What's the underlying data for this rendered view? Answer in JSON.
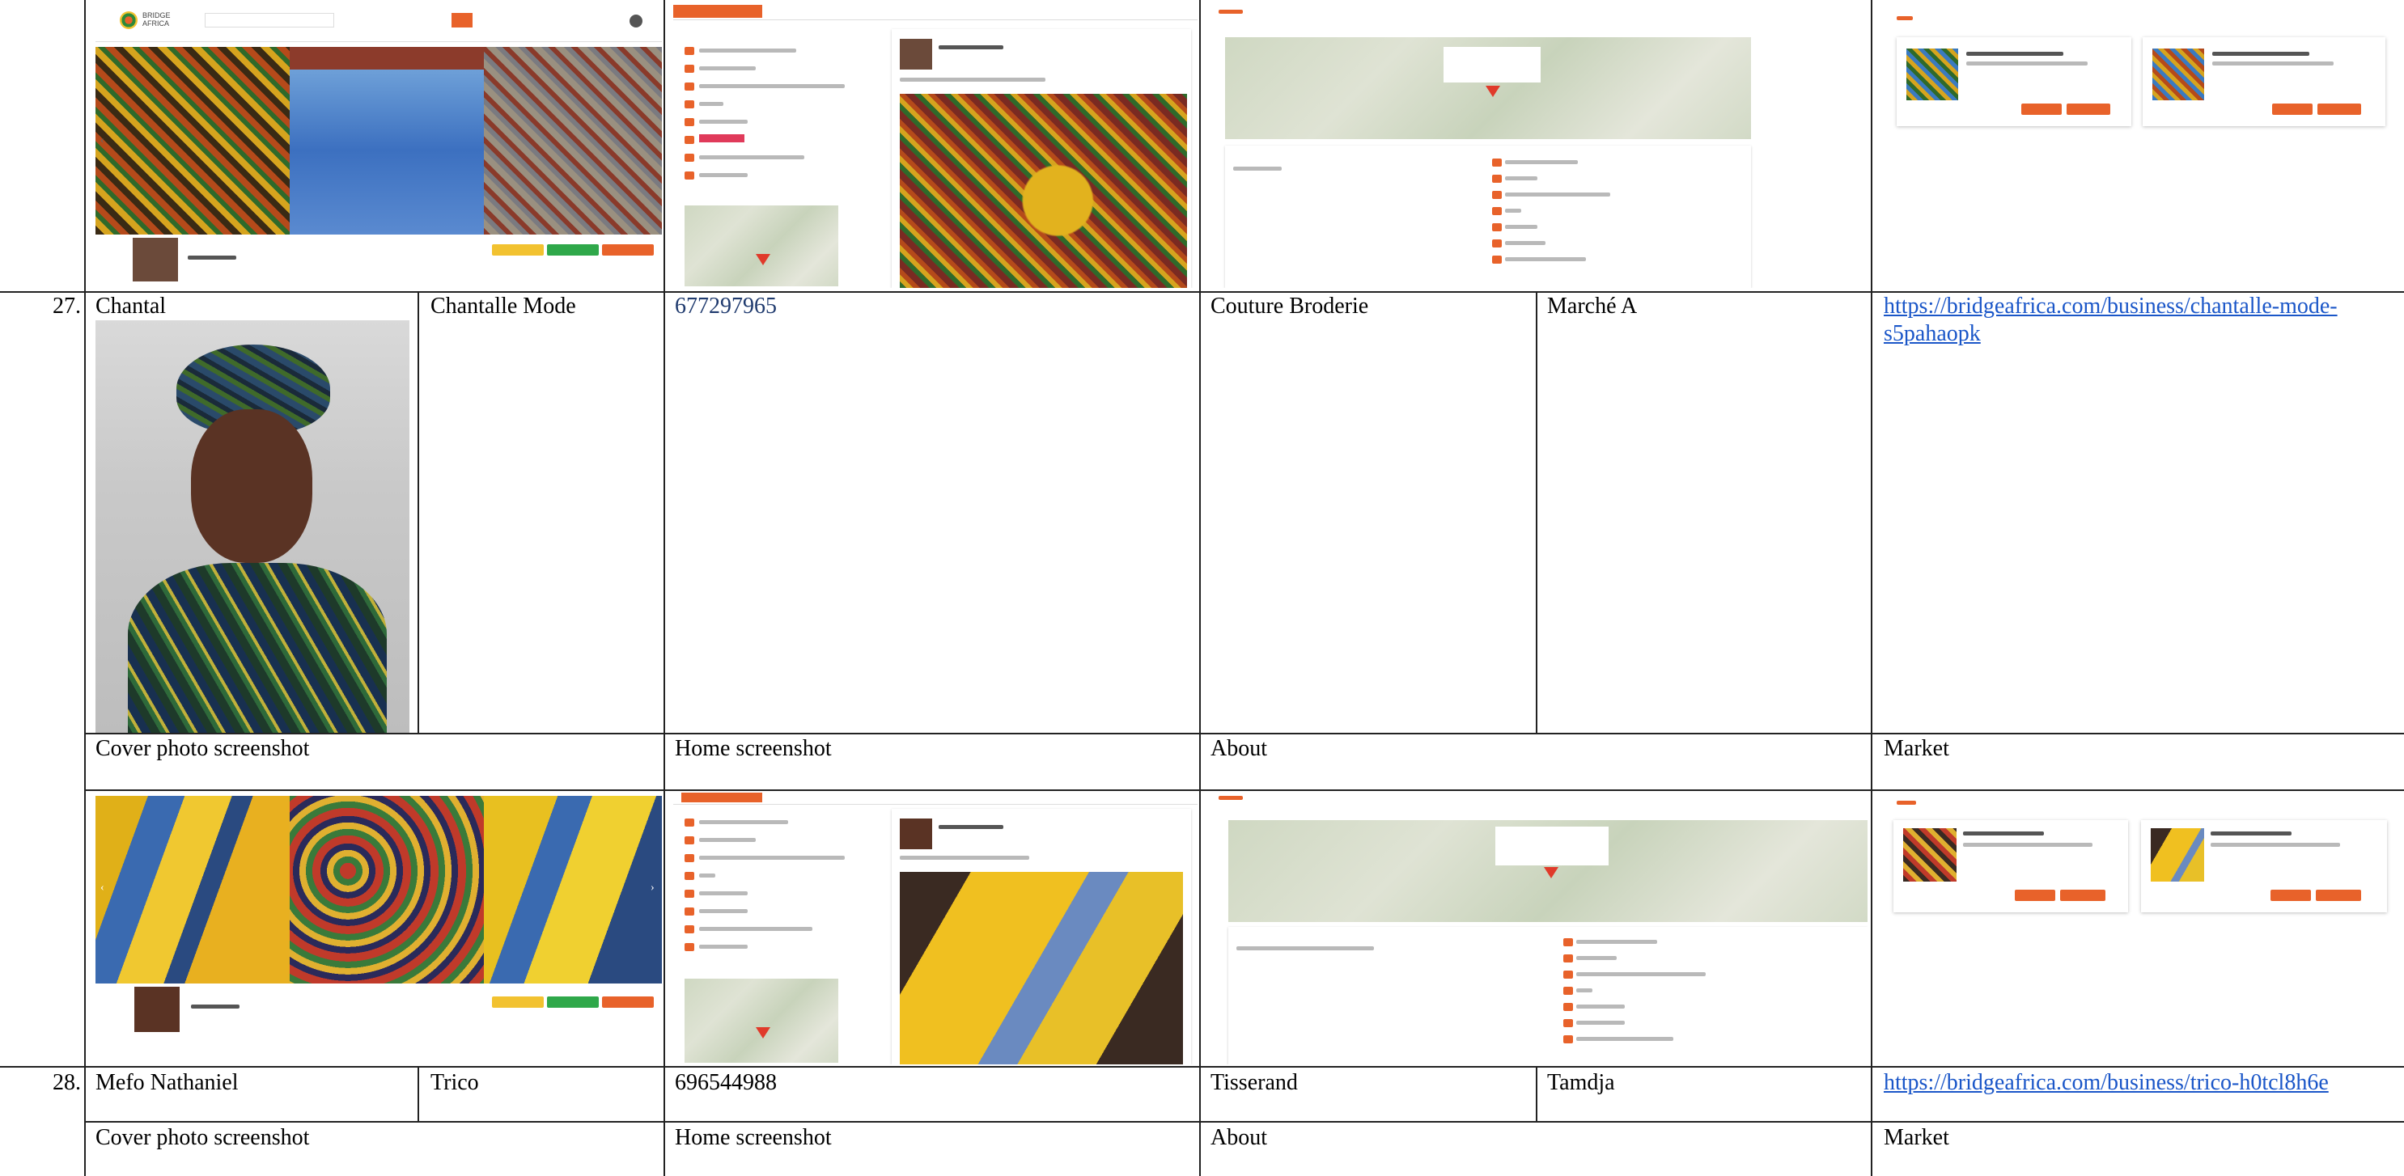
{
  "rows": [
    {
      "number": "27.",
      "owner": "Chantal",
      "business": "Chantalle Mode",
      "phone": "677297965",
      "category": "Couture Broderie",
      "location": "Marché A",
      "url": "https://bridgeafrica.com/business/chantalle-mode-s5pahaopk",
      "url_line1": "https://bridgeafrica.com/business/chantalle-mode-",
      "url_line2": "s5pahaopk",
      "labels": {
        "cover": "Cover photo screenshot",
        "home": "Home screenshot",
        "about": "About",
        "market": "Market"
      }
    },
    {
      "number": "28.",
      "owner": "Mefo Nathaniel",
      "business": "Trico",
      "phone": "696544988",
      "category": "Tisserand",
      "location": "Tamdja",
      "url": "https://bridgeafrica.com/business/trico-h0tcl8h6e",
      "labels": {
        "cover": "Cover photo screenshot",
        "home": "Home screenshot",
        "about": "About",
        "market": "Market"
      }
    }
  ],
  "brand": {
    "logo_text_line1": "BRIDGE",
    "logo_text_line2": "AFRICA",
    "accent": "#e8622a"
  },
  "icons": [
    "chevron-left-icon",
    "chevron-right-icon",
    "map-pin-icon",
    "search-icon"
  ]
}
